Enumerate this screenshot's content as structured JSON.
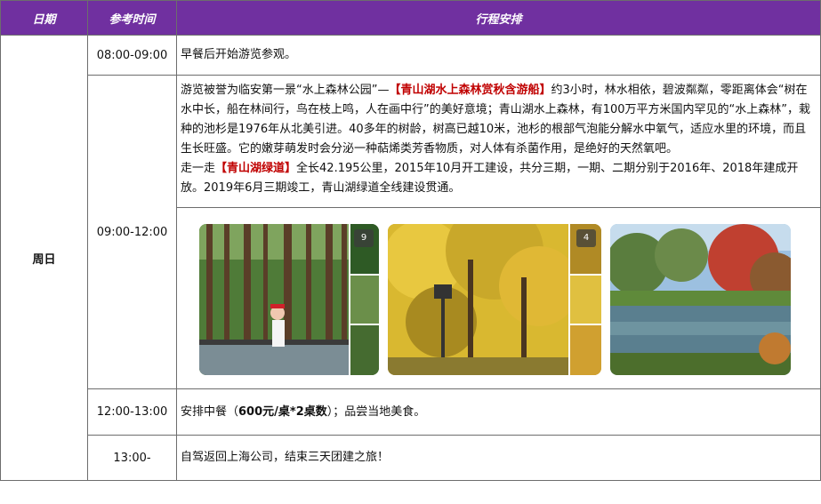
{
  "header": {
    "col_date": "日期",
    "col_time": "参考时间",
    "col_plan": "行程安排"
  },
  "day_label": "周日",
  "rows": {
    "r1": {
      "time": "08:00-09:00",
      "text": "早餐后开始游览参观。"
    },
    "r2": {
      "time": "09:00-12:00",
      "p1_pre": "游览被誉为临安第一景“水上森林公园”—",
      "p1_highlight": "【青山湖水上森林赏秋含游船】",
      "p1_post": "约3小时，林水相依，碧波粼粼，零距离体会“树在水中长，船在林间行，鸟在枝上鸣，人在画中行”的美好意境；青山湖水上森林，有100万平方米国内罕见的“水上森林”，栽种的池杉是1976年从北美引进。40多年的树龄，树高已越10米，池杉的根部气泡能分解水中氧气，适应水里的环境，而且生长旺盛。它的嫩芽萌发时会分泌一种萜烯类芳香物质，对人体有杀菌作用，是绝好的天然氧吧。",
      "p2_pre": "走一走",
      "p2_highlight": "【青山湖绿道】",
      "p2_post": "全长42.195公里，2015年10月开工建设，共分三期，一期、二期分别于2016年、2018年建成开放。2019年6月三期竣工，青山湖绿道全线建设贯通。",
      "photo1_badge": "9",
      "photo2_badge": "4"
    },
    "r3": {
      "time": "12:00-13:00",
      "pre": "安排中餐（",
      "bold": "600元/桌*2桌数",
      "post": "）；品尝当地美食。"
    },
    "r4": {
      "time": "13:00-",
      "text": "自驾返回上海公司，结束三天团建之旅！"
    }
  },
  "colors": {
    "header_bg": "#7030a0",
    "highlight": "#c00000"
  }
}
